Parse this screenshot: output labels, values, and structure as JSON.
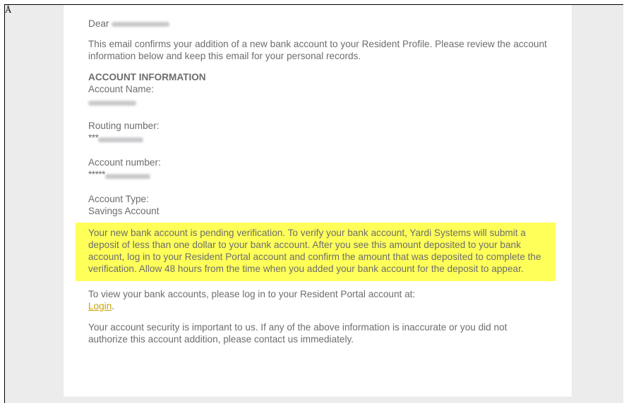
{
  "corner_glyph": "Å",
  "email": {
    "salutation": "Dear",
    "intro": "This email confirms your addition of a new bank account to your Resident Profile. Please review the account information below and keep this email for your personal records.",
    "section_heading": "ACCOUNT INFORMATION",
    "fields": [
      {
        "label": "Account Name:"
      },
      {
        "label": "Routing number:",
        "mask_prefix": "***"
      },
      {
        "label": "Account number:",
        "mask_prefix": "*****"
      },
      {
        "label": "Account Type:",
        "value": "Savings Account"
      }
    ],
    "verification_notice": "Your new bank account is pending verification. To verify your bank account, Yardi Systems will submit a deposit of less than one dollar to your bank account. After you see this amount deposited to your bank account, log in to your Resident Portal account and confirm the amount that was deposited to complete the verification. Allow 48 hours from the time when you added your bank account for the deposit to appear.",
    "view_accounts_text": "To view your bank accounts, please log in to your Resident Portal account at:",
    "login_link": "Login",
    "login_suffix": ".",
    "security_text": "Your account security is important to us. If any of the above information is inaccurate or you did not authorize this account addition, please contact us immediately."
  },
  "colors": {
    "highlight": "#ffff5a",
    "body_text": "#6d6d6d",
    "link": "#c9a300",
    "page_background": "#ececec"
  }
}
